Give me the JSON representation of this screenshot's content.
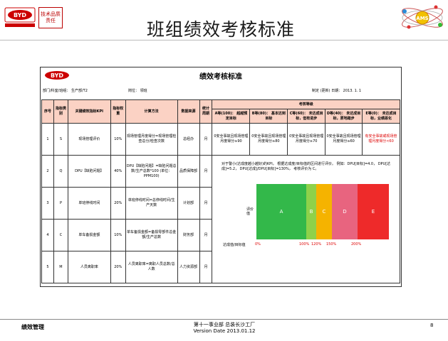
{
  "header": {
    "title": "班组绩效考核标准",
    "brand_motto": "技术品质责任",
    "ams_label": "AMS"
  },
  "doc": {
    "logo_text": "BYD",
    "title": "绩效考核标准",
    "dept_info": "部门/科室/班组： 生产部/T2",
    "post_info": "岗位： 领班",
    "date_info": "制定 (更新) 日期： 2013. 1. 1"
  },
  "table": {
    "headers": {
      "seq": "序号",
      "category": "指标类别",
      "kpi": "关键绩效指标KPI",
      "weight": "指标权重",
      "method": "计算方法",
      "source": "数据来源",
      "period": "统计周期",
      "grade": "考核等级"
    },
    "levels": [
      "A等(100)： 超越预定目标",
      "B等(80)： 基本达到目标",
      "C等(60)： 未达成目标，但有进步",
      "D等(40)： 未达成目标，原地踏步",
      "E等(0)： 未达成目标，业绩恶化"
    ],
    "rows": [
      {
        "seq": "1",
        "category": "S",
        "kpi": "现场管理评价",
        "weight": "10%",
        "method": "现场管理月度得分=现场管理检查总分/检查次数",
        "source": "总经办",
        "period": "月",
        "grades": [
          "0安全事故且现场管理月度得分≥90",
          "0安全事故且现场管理月度得分≥80",
          "0安全事故且现场管理月度得分≥70",
          "0安全事故且现场管理月度得分≥60",
          "有安全事故或现场管理月度得分<60"
        ]
      },
      {
        "seq": "2",
        "category": "Q",
        "kpi": "DPU【缺陷问题】",
        "weight": "40%",
        "method": "DPU【缺陷问题】=缺陷问题总数/生产总数*100 (单位：PPM100)",
        "source": "品质保障部",
        "period": "月"
      },
      {
        "seq": "3",
        "category": "P",
        "kpi": "单班停线时间",
        "weight": "20%",
        "method": "单班停线时间=总停线时间/生产天数",
        "source": "计划部",
        "period": "月"
      },
      {
        "seq": "4",
        "category": "C",
        "kpi": "单车备损金额",
        "weight": "10%",
        "method": "单车备损金额=备损零部件总金额/生产总数",
        "source": "财务部",
        "period": "月"
      },
      {
        "seq": "5",
        "category": "M",
        "kpi": "人员离职率",
        "weight": "20%",
        "method": "人员离职率=离职人员总数/总人数",
        "source": "人力资源部",
        "period": "月"
      }
    ]
  },
  "chart": {
    "note": "对于警小(达成度越小越好)的KPI， 根据达成度/目标值的区间进行评价。 例如：DPU[目标]=4.0， DPU[达成]=5.2， DPU[达成]/DPU[目标]=130%， 考核评价为 C。",
    "y_label": "评价值",
    "x_label": "达成值/目标值",
    "bands": [
      {
        "label": "A",
        "color": "#33b84a"
      },
      {
        "label": "B",
        "color": "#8fd14a"
      },
      {
        "label": "C",
        "color": "#f5b300"
      },
      {
        "label": "D",
        "color": "#e8647f"
      },
      {
        "label": "E",
        "color": "#ee2a2a"
      }
    ],
    "ticks": [
      "0%",
      "100%",
      "120%",
      "150%",
      "200%"
    ]
  },
  "footer": {
    "left": "绩效管理",
    "center_line1": "第十一事业部 总装长沙工厂",
    "center_line2": "Version Date 2013.01.12",
    "page": "8"
  }
}
